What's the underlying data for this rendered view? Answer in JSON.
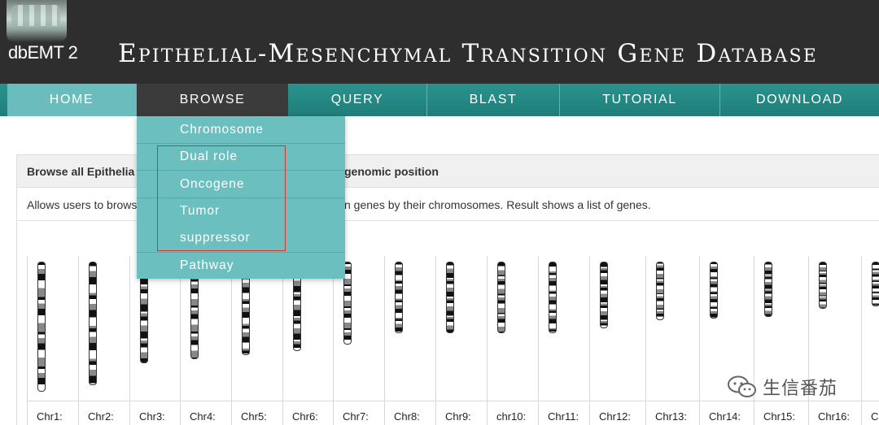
{
  "header": {
    "logo_text": "dbEMT 2",
    "title": "Epithelial-Mesenchymal Transition Gene Database"
  },
  "nav": {
    "items": [
      {
        "label": "HOME"
      },
      {
        "label": "BROWSE"
      },
      {
        "label": "QUERY"
      },
      {
        "label": "BLAST"
      },
      {
        "label": "TUTORIAL"
      },
      {
        "label": "DOWNLOAD"
      }
    ]
  },
  "dropdown": {
    "items": [
      {
        "label": "Chromosome"
      },
      {
        "label": "Dual role"
      },
      {
        "label": "Oncogene"
      },
      {
        "label": "Tumor"
      },
      {
        "label": "suppressor"
      },
      {
        "label": "Pathway"
      }
    ],
    "highlight_color": "#d9302c"
  },
  "panel": {
    "title_left": "Browse all Epithelia",
    "title_right": "genomic position",
    "desc_left": "Allows users to brows",
    "desc_right": "n genes by their chromosomes. Result shows a list of genes."
  },
  "chromosomes": [
    {
      "label": "Chr1:"
    },
    {
      "label": "Chr2:"
    },
    {
      "label": "Chr3:"
    },
    {
      "label": "Chr4:"
    },
    {
      "label": "Chr5:"
    },
    {
      "label": "Chr6:"
    },
    {
      "label": "Chr7:"
    },
    {
      "label": "Chr8:"
    },
    {
      "label": "Chr9:"
    },
    {
      "label": "chr10:"
    },
    {
      "label": "Chr11:"
    },
    {
      "label": "Chr12:"
    },
    {
      "label": "Chr13:"
    },
    {
      "label": "Chr14:"
    },
    {
      "label": "Chr15:"
    },
    {
      "label": "Chr16:"
    },
    {
      "label": "C"
    }
  ],
  "watermark": {
    "text": "生信番茄"
  },
  "colors": {
    "header_bg": "#2e2e2e",
    "nav_bg": "#24898a",
    "nav_active": "#3b3b3b",
    "nav_home": "#6bbdbd",
    "dropdown_bg": "#6cbfbf"
  }
}
